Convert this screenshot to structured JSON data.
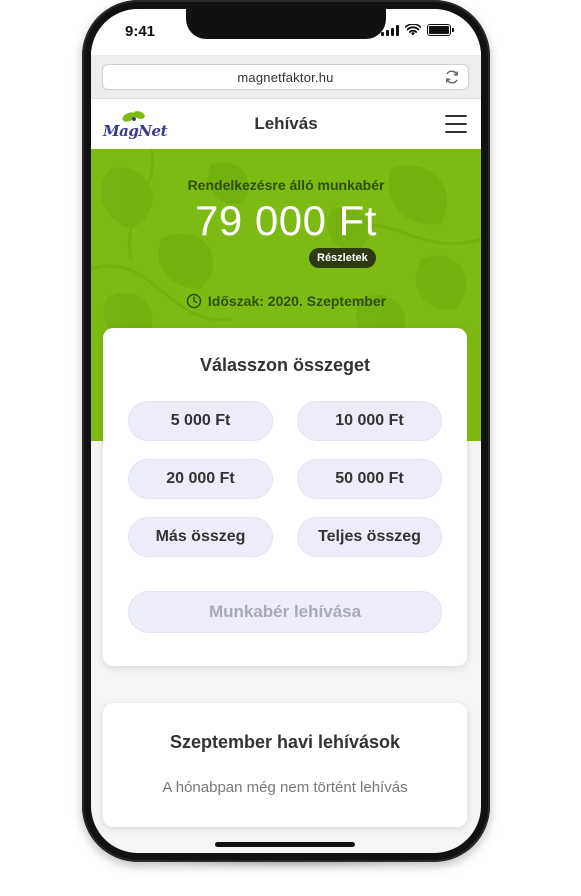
{
  "status_bar": {
    "time": "9:41"
  },
  "browser": {
    "url": "magnetfaktor.hu",
    "reload_icon": "reload-icon"
  },
  "header": {
    "logo_text": "MagNet",
    "title": "Lehívás",
    "menu_icon": "hamburger-menu-icon"
  },
  "hero": {
    "label": "Rendelkezésre álló munkabér",
    "amount": "79 000 Ft",
    "details_label": "Részletek",
    "period": "Időszak: 2020. Szeptember",
    "background_color": "#7dbb14"
  },
  "select_card": {
    "title": "Válasszon összeget",
    "options": [
      "5 000 Ft",
      "10 000 Ft",
      "20 000 Ft",
      "50 000 Ft",
      "Más összeg",
      "Teljes összeg"
    ],
    "submit_label": "Munkabér lehívása"
  },
  "history_card": {
    "title": "Szeptember havi lehívások",
    "empty_message": "A hónabpan még nem történt lehívás"
  },
  "colors": {
    "accent": "#7dbb14",
    "button_bg": "#ecedf8",
    "badge_bg": "#2d3a14"
  }
}
